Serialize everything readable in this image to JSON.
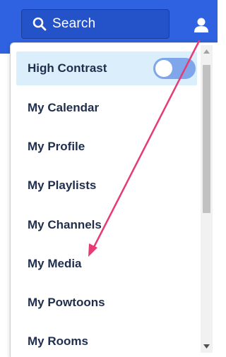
{
  "header": {
    "search": {
      "label": "Search",
      "icon": "search-icon"
    },
    "user_icon": "user-icon",
    "bar_color": "#2f62e0"
  },
  "menu": {
    "items": [
      {
        "label": "High Contrast",
        "highlighted": true,
        "toggle": {
          "state": "off"
        }
      },
      {
        "label": "My Calendar"
      },
      {
        "label": "My Profile"
      },
      {
        "label": "My Playlists"
      },
      {
        "label": "My Channels"
      },
      {
        "label": "My Media"
      },
      {
        "label": "My Powtoons"
      },
      {
        "label": "My Rooms"
      }
    ]
  },
  "annotation": {
    "type": "arrow",
    "color": "#e83a74"
  }
}
